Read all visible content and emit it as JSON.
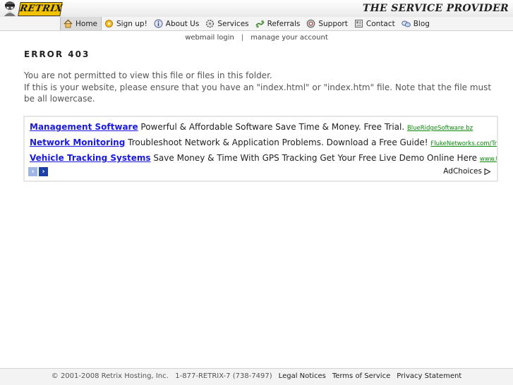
{
  "header": {
    "logo_text": "RETRIX",
    "tagline": "THE SERVICE PROVIDER"
  },
  "nav": {
    "items": [
      {
        "label": "Home",
        "icon": "home-icon"
      },
      {
        "label": "Sign up!",
        "icon": "signup-icon"
      },
      {
        "label": "About Us",
        "icon": "info-icon"
      },
      {
        "label": "Services",
        "icon": "services-icon"
      },
      {
        "label": "Referrals",
        "icon": "referrals-icon"
      },
      {
        "label": "Support",
        "icon": "support-icon"
      },
      {
        "label": "Contact",
        "icon": "contact-icon"
      },
      {
        "label": "Blog",
        "icon": "blog-icon"
      }
    ]
  },
  "sublinks": {
    "webmail": "webmail login",
    "separator": "|",
    "manage": "manage your account"
  },
  "main": {
    "error_title": "ERROR 403",
    "line1": "You are not permitted to view this file or files in this folder.",
    "line2": "If this is your website, please ensure that you have an \"index.html\" or \"index.htm\" file. Note that the file must be all lowercase."
  },
  "ads": {
    "items": [
      {
        "title": "Management Software",
        "text": " Powerful & Affordable Software Save Time & Money. Free Trial. ",
        "url": "BlueRidgeSoftware.bz"
      },
      {
        "title": "Network Monitoring",
        "text": " Troubleshoot Network & Application Problems. Download a Free Guide! ",
        "url": "FlukeNetworks.com/Troubleshoot-Apps"
      },
      {
        "title": "Vehicle Tracking Systems",
        "text": " Save Money & Time With GPS Tracking Get Your Free Live Demo Online Here ",
        "url": "www.teletrac.net"
      }
    ],
    "prev": "‹",
    "next": "›",
    "adchoices": "AdChoices"
  },
  "footer": {
    "copyright": "© 2001-2008 Retrix Hosting, Inc.   1-877-RETRIX-7 (738-7497)",
    "legal": "Legal Notices",
    "terms": "Terms of Service",
    "privacy": "Privacy Statement"
  }
}
